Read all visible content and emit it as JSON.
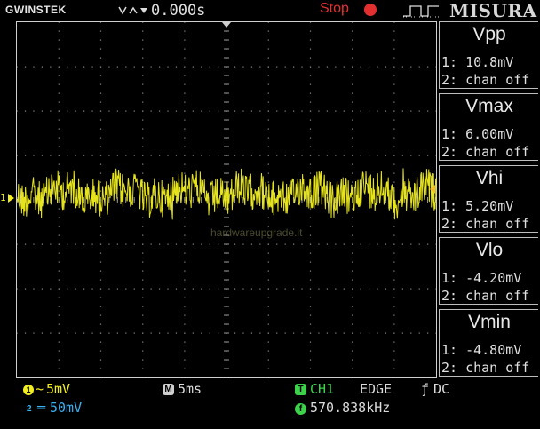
{
  "header": {
    "brand": "GWINSTEK",
    "time_offset": "0.000s",
    "run_state": "Stop",
    "watermark_brand": "MISURA"
  },
  "grid_watermark": "hardwareupgrade.it",
  "measurements": [
    {
      "title": "Vpp",
      "ch1": "1: 10.8mV",
      "ch2": "2: chan off"
    },
    {
      "title": "Vmax",
      "ch1": "1: 6.00mV",
      "ch2": "2: chan off"
    },
    {
      "title": "Vhi",
      "ch1": "1: 5.20mV",
      "ch2": "2: chan off"
    },
    {
      "title": "Vlo",
      "ch1": "1: -4.20mV",
      "ch2": "2: chan off"
    },
    {
      "title": "Vmin",
      "ch1": "1: -4.80mV",
      "ch2": "2: chan off"
    }
  ],
  "footer": {
    "ch1_scale": "5mV",
    "ch2_scale": "50mV",
    "timebase": "5ms",
    "trigger_source": "CH1",
    "trigger_type": "EDGE",
    "trigger_coupling": "DC",
    "frequency": "570.838kHz"
  },
  "colors": {
    "ch1": "#f1ee20",
    "ch2": "#3ab0f0",
    "stop": "#e23030",
    "trigger": "#3cd24a"
  },
  "icons": {
    "trigger_shape": "rising-pulse-icon",
    "coupling": "dc-coupling-icon"
  }
}
